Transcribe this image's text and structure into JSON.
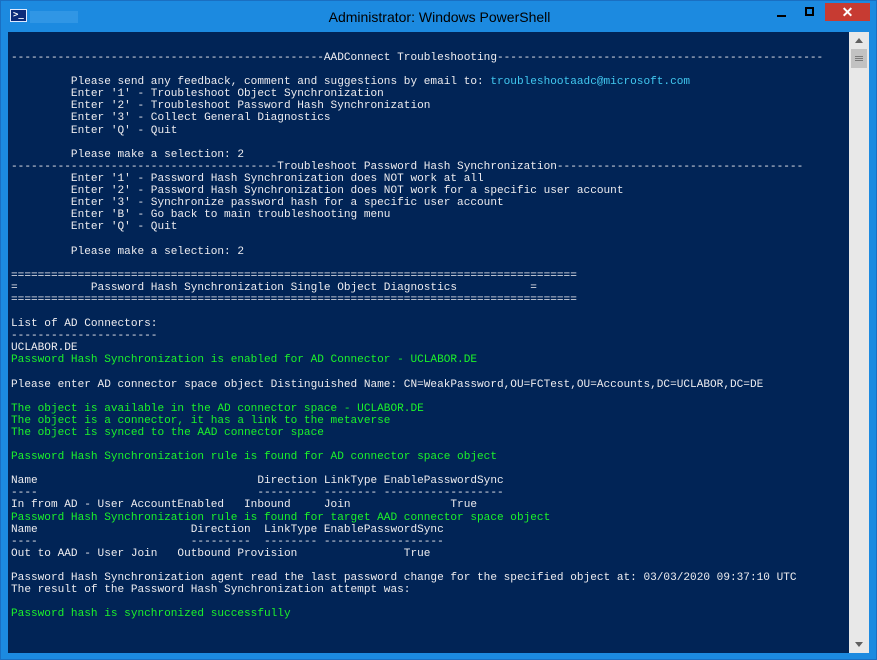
{
  "window": {
    "title": "Administrator: Windows PowerShell",
    "app_icon_glyph": ">_",
    "close_glyph": "✕"
  },
  "console": {
    "lines": [
      {
        "text": "-----------------------------------------------AADConnect Troubleshooting-------------------------------------------------",
        "color": "default"
      },
      {
        "text": "",
        "color": "default"
      },
      {
        "text": "         Please send any feedback, comment and suggestions by email to: ",
        "color": "default",
        "suffix": "troubleshootaadc@microsoft.com",
        "suffix_color": "cyan"
      },
      {
        "text": "         Enter '1' - Troubleshoot Object Synchronization",
        "color": "default"
      },
      {
        "text": "         Enter '2' - Troubleshoot Password Hash Synchronization",
        "color": "default"
      },
      {
        "text": "         Enter '3' - Collect General Diagnostics",
        "color": "default"
      },
      {
        "text": "         Enter 'Q' - Quit",
        "color": "default"
      },
      {
        "text": "",
        "color": "default"
      },
      {
        "text": "         Please make a selection: 2",
        "color": "default"
      },
      {
        "text": "----------------------------------------Troubleshoot Password Hash Synchronization-------------------------------------",
        "color": "default"
      },
      {
        "text": "         Enter '1' - Password Hash Synchronization does NOT work at all",
        "color": "default"
      },
      {
        "text": "         Enter '2' - Password Hash Synchronization does NOT work for a specific user account",
        "color": "default"
      },
      {
        "text": "         Enter '3' - Synchronize password hash for a specific user account",
        "color": "default"
      },
      {
        "text": "         Enter 'B' - Go back to main troubleshooting menu",
        "color": "default"
      },
      {
        "text": "         Enter 'Q' - Quit",
        "color": "default"
      },
      {
        "text": "",
        "color": "default"
      },
      {
        "text": "         Please make a selection: 2",
        "color": "default"
      },
      {
        "text": "",
        "color": "default"
      },
      {
        "text": "=====================================================================================",
        "color": "default"
      },
      {
        "text": "=           Password Hash Synchronization Single Object Diagnostics           =",
        "color": "default"
      },
      {
        "text": "=====================================================================================",
        "color": "default"
      },
      {
        "text": "",
        "color": "default"
      },
      {
        "text": "List of AD Connectors:",
        "color": "default"
      },
      {
        "text": "----------------------",
        "color": "default"
      },
      {
        "text": "UCLABOR.DE",
        "color": "default"
      },
      {
        "text": "Password Hash Synchronization is enabled for AD Connector - UCLABOR.DE",
        "color": "green"
      },
      {
        "text": "",
        "color": "default"
      },
      {
        "text": "Please enter AD connector space object Distinguished Name: CN=WeakPassword,OU=FCTest,OU=Accounts,DC=UCLABOR,DC=DE",
        "color": "default"
      },
      {
        "text": "",
        "color": "default"
      },
      {
        "text": "The object is available in the AD connector space - UCLABOR.DE",
        "color": "green"
      },
      {
        "text": "The object is a connector, it has a link to the metaverse",
        "color": "green"
      },
      {
        "text": "The object is synced to the AAD connector space",
        "color": "green"
      },
      {
        "text": "",
        "color": "default"
      },
      {
        "text": "Password Hash Synchronization rule is found for AD connector space object",
        "color": "green"
      },
      {
        "text": "",
        "color": "default"
      },
      {
        "text": "Name                                 Direction LinkType EnablePasswordSync",
        "color": "default"
      },
      {
        "text": "----                                 --------- -------- ------------------",
        "color": "default"
      },
      {
        "text": "In from AD - User AccountEnabled   Inbound     Join               True",
        "color": "default"
      },
      {
        "text": "Password Hash Synchronization rule is found for target AAD connector space object",
        "color": "green"
      },
      {
        "text": "Name                       Direction  LinkType EnablePasswordSync",
        "color": "default"
      },
      {
        "text": "----                       ---------  -------- ------------------",
        "color": "default"
      },
      {
        "text": "Out to AAD - User Join   Outbound Provision                True",
        "color": "default"
      },
      {
        "text": "",
        "color": "default"
      },
      {
        "text": "Password Hash Synchronization agent read the last password change for the specified object at: 03/03/2020 09:37:10 UTC",
        "color": "default"
      },
      {
        "text": "The result of the Password Hash Synchronization attempt was:",
        "color": "default"
      },
      {
        "text": "",
        "color": "default"
      },
      {
        "text": "Password hash is synchronized successfully",
        "color": "green"
      }
    ]
  }
}
